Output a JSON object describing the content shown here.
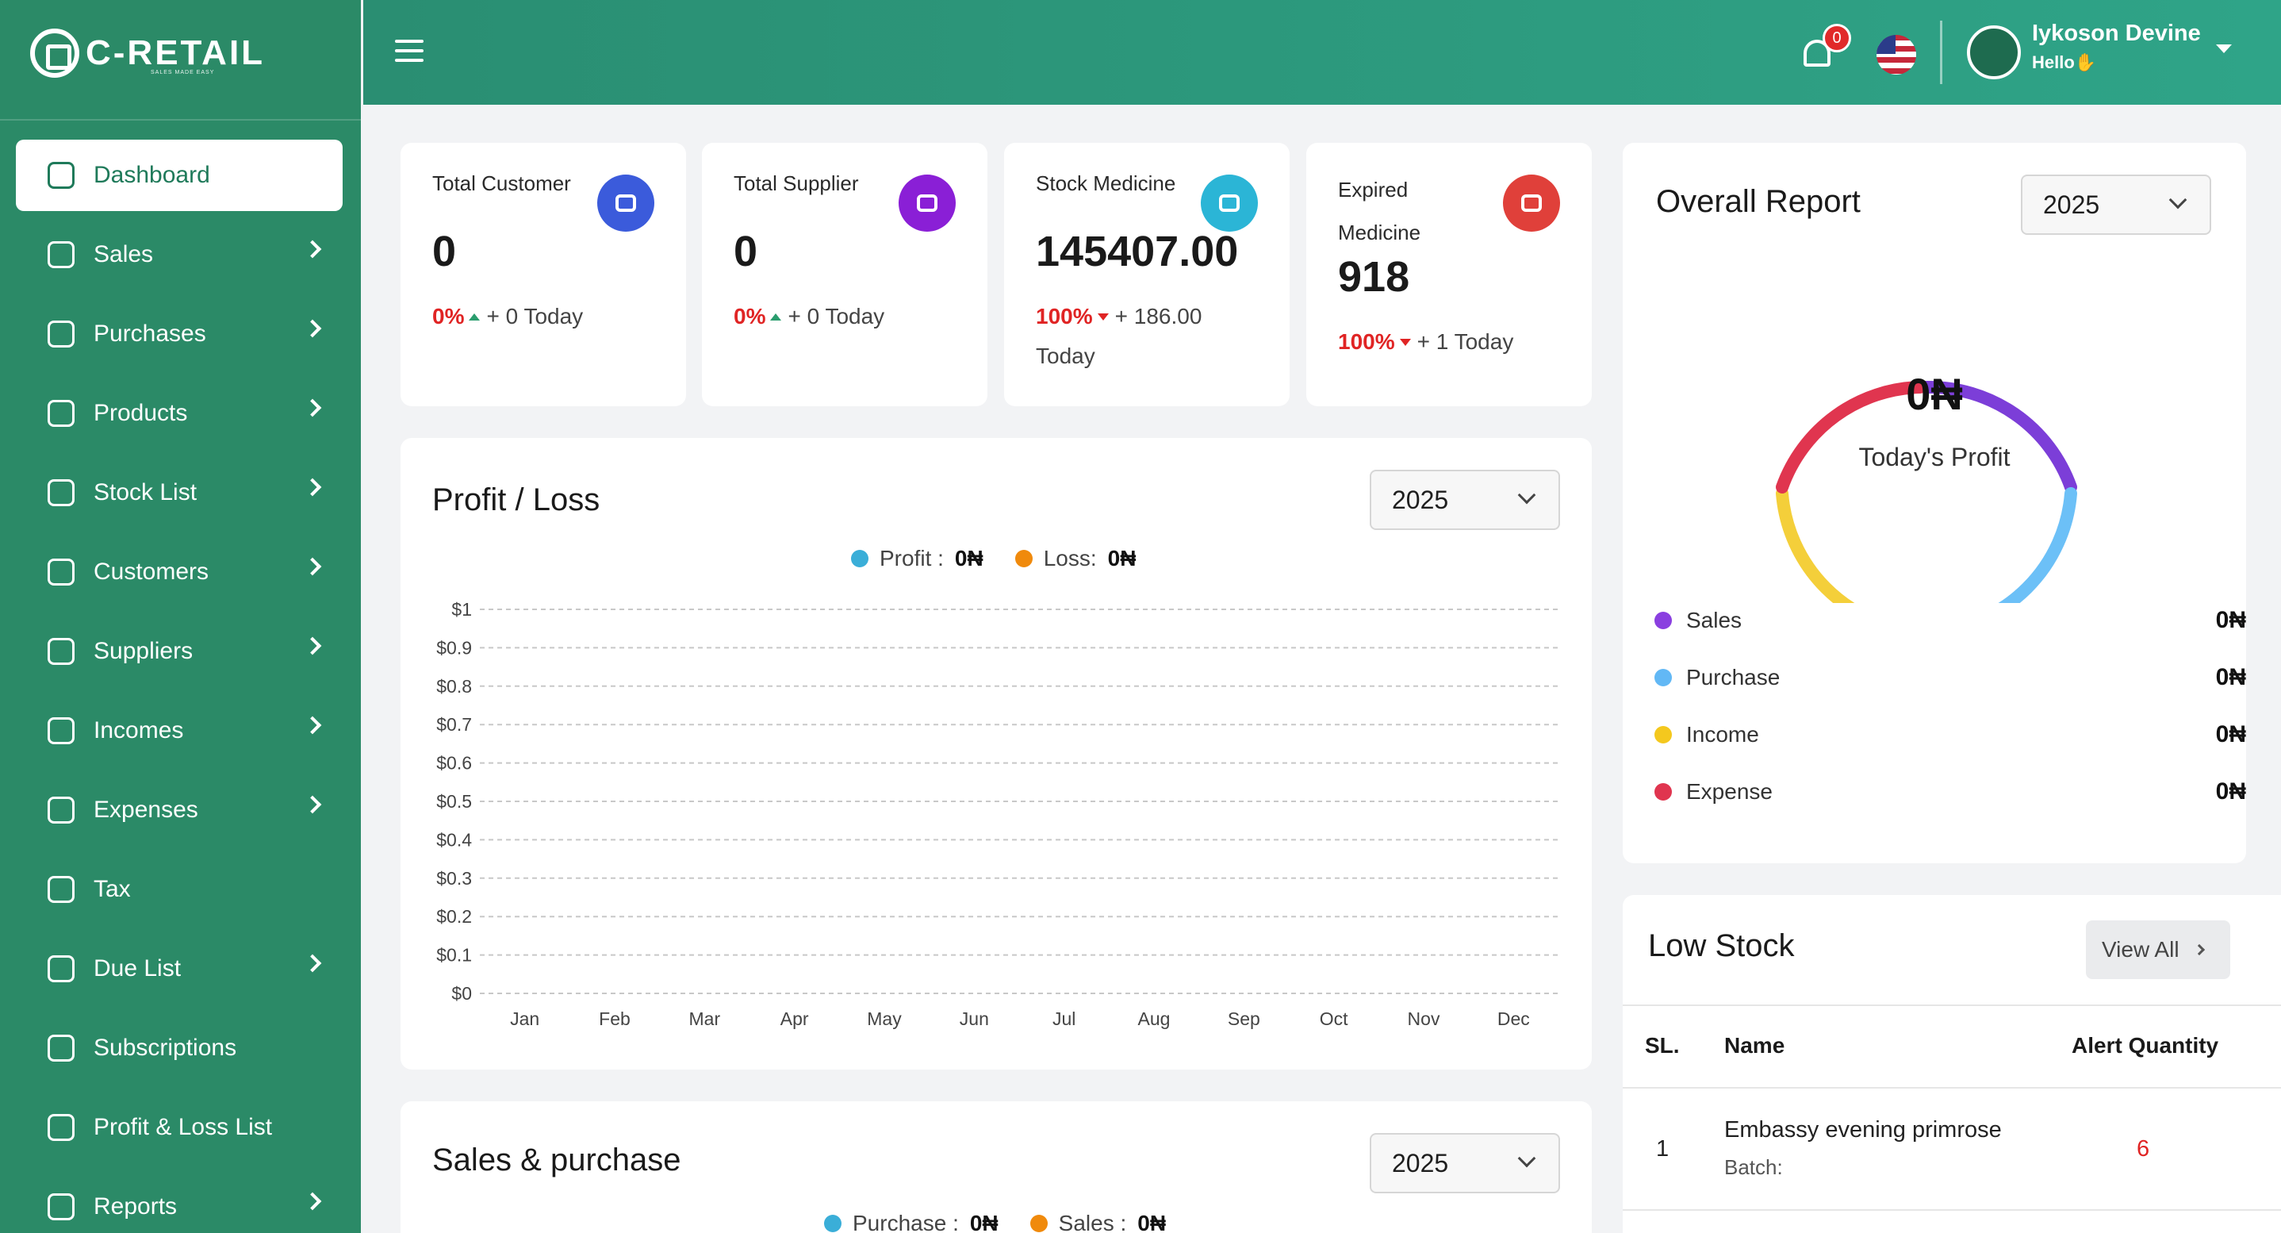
{
  "brand": {
    "name": "C-RETAIL",
    "tagline": "SALES MADE EASY"
  },
  "sidebar": {
    "items": [
      {
        "label": "Dashboard",
        "icon": "home-icon",
        "active": true,
        "has_children": false
      },
      {
        "label": "Sales",
        "icon": "tag-icon",
        "has_children": true
      },
      {
        "label": "Purchases",
        "icon": "cart-icon",
        "has_children": true
      },
      {
        "label": "Products",
        "icon": "bottle-icon",
        "has_children": true
      },
      {
        "label": "Stock List",
        "icon": "box-icon",
        "has_children": true
      },
      {
        "label": "Customers",
        "icon": "users-icon",
        "has_children": true
      },
      {
        "label": "Suppliers",
        "icon": "supplier-icon",
        "has_children": true
      },
      {
        "label": "Incomes",
        "icon": "coins-icon",
        "has_children": true
      },
      {
        "label": "Expenses",
        "icon": "wallet-icon",
        "has_children": true
      },
      {
        "label": "Tax",
        "icon": "percent-icon",
        "has_children": false
      },
      {
        "label": "Due List",
        "icon": "clipboard-icon",
        "has_children": true
      },
      {
        "label": "Subscriptions",
        "icon": "diamond-icon",
        "has_children": false
      },
      {
        "label": "Profit & Loss List",
        "icon": "chart-icon",
        "has_children": false
      },
      {
        "label": "Reports",
        "icon": "report-icon",
        "has_children": true
      }
    ]
  },
  "header": {
    "notification_count": "0",
    "user_name": "Iykoson Devine",
    "user_greeting": "Hello✋"
  },
  "stats": [
    {
      "title": "Total Customer",
      "value": "0",
      "pct": "0%",
      "trend": "up",
      "delta": "+ 0 Today",
      "icon": "customers-icon",
      "color": "#3b5bdb"
    },
    {
      "title": "Total Supplier",
      "value": "0",
      "pct": "0%",
      "trend": "up",
      "delta": "+ 0 Today",
      "icon": "supplier-icon",
      "color": "#8a1fd6"
    },
    {
      "title": "Stock Medicine",
      "value": "145407.00",
      "pct": "100%",
      "trend": "down",
      "delta": "+ 186.00",
      "delta2": "Today",
      "icon": "pill-icon",
      "color": "#2bb5d6"
    },
    {
      "title": "Expired Medicine",
      "value": "918",
      "pct": "100%",
      "trend": "down",
      "delta": "+ 1 Today",
      "icon": "expired-icon",
      "color": "#e0403a"
    }
  ],
  "profit_loss": {
    "title": "Profit / Loss",
    "year": "2025",
    "legend": [
      {
        "label": "Profit :",
        "value": "0₦",
        "color": "#3aaed8"
      },
      {
        "label": "Loss:",
        "value": "0₦",
        "color": "#f08a0c"
      }
    ]
  },
  "chart_data": {
    "type": "line",
    "categories": [
      "Jan",
      "Feb",
      "Mar",
      "Apr",
      "May",
      "Jun",
      "Jul",
      "Aug",
      "Sep",
      "Oct",
      "Nov",
      "Dec"
    ],
    "series": [
      {
        "name": "Profit",
        "values": [
          0,
          0,
          0,
          0,
          0,
          0,
          0,
          0,
          0,
          0,
          0,
          0
        ]
      },
      {
        "name": "Loss",
        "values": [
          0,
          0,
          0,
          0,
          0,
          0,
          0,
          0,
          0,
          0,
          0,
          0
        ]
      }
    ],
    "yticks": [
      "$0",
      "$0.1",
      "$0.2",
      "$0.3",
      "$0.4",
      "$0.5",
      "$0.6",
      "$0.7",
      "$0.8",
      "$0.9",
      "$1"
    ],
    "ylim": [
      0,
      1
    ],
    "grid": true
  },
  "sales_purchase": {
    "title": "Sales & purchase",
    "year": "2025",
    "legend": [
      {
        "label": "Purchase :",
        "value": "0₦",
        "color": "#3aaed8"
      },
      {
        "label": "Sales :",
        "value": "0₦",
        "color": "#f08a0c"
      }
    ]
  },
  "overall_report": {
    "title": "Overall Report",
    "year": "2025",
    "center_value": "0₦",
    "center_label": "Today's Profit",
    "rows": [
      {
        "label": "Sales",
        "value": "0₦",
        "color": "#8a3fe0"
      },
      {
        "label": "Purchase",
        "value": "0₦",
        "color": "#62b8f5"
      },
      {
        "label": "Income",
        "value": "0₦",
        "color": "#f4c81e"
      },
      {
        "label": "Expense",
        "value": "0₦",
        "color": "#e0354f"
      }
    ]
  },
  "low_stock": {
    "title": "Low Stock",
    "view_all": "View All",
    "columns": [
      "SL.",
      "Name",
      "Alert Quantity"
    ],
    "rows": [
      {
        "sl": "1",
        "name": "Embassy evening primrose",
        "batch": "Batch:",
        "qty": "6"
      }
    ]
  }
}
